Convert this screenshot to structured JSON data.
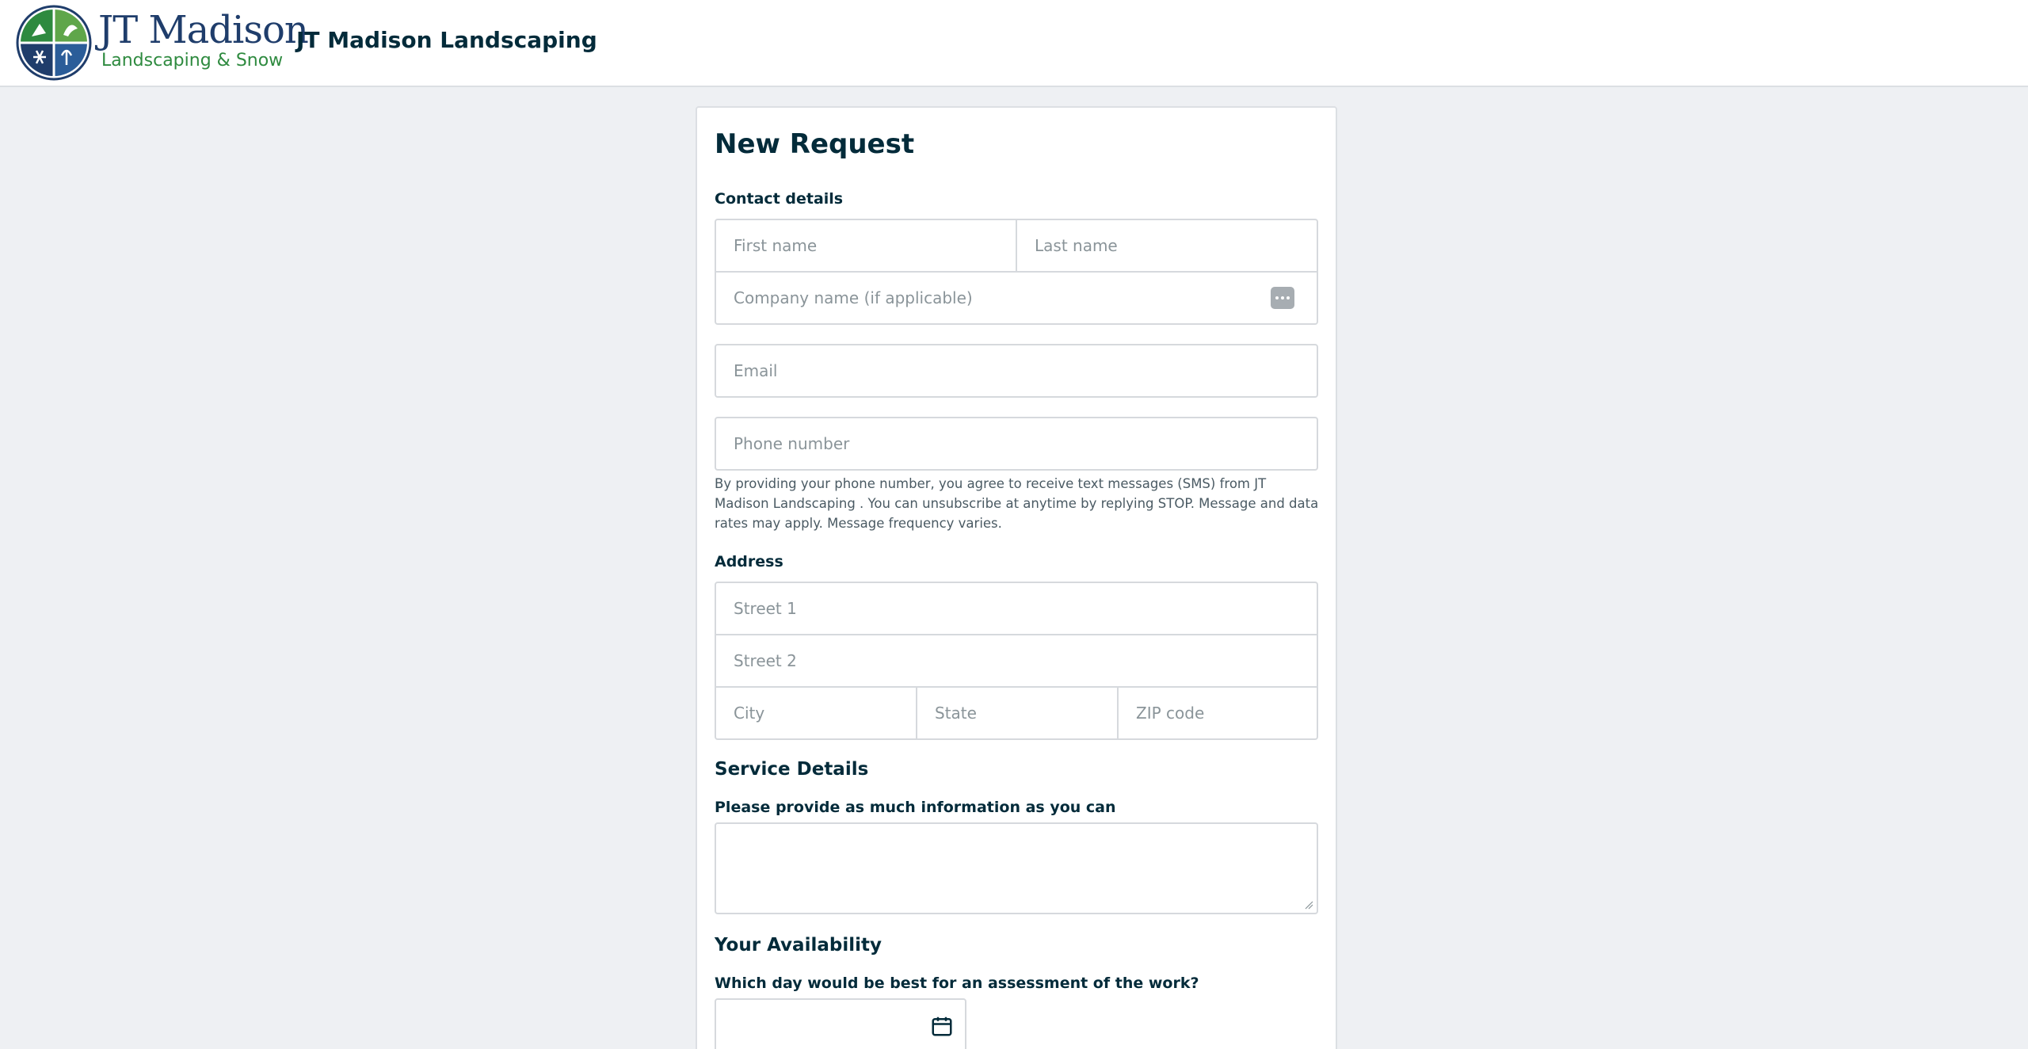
{
  "header": {
    "logo": {
      "wordmark": "JT Madison",
      "tagline": "Landscaping & Snow",
      "icon": "logo-seal-icon"
    },
    "company_name": "JT Madison Landscaping"
  },
  "form": {
    "title": "New Request",
    "contact": {
      "heading": "Contact details",
      "first_name_placeholder": "First name",
      "last_name_placeholder": "Last name",
      "company_placeholder": "Company name (if applicable)",
      "email_placeholder": "Email",
      "phone_placeholder": "Phone number",
      "sms_disclaimer": "By providing your phone number, you agree to receive text messages (SMS) from JT Madison Landscaping . You can unsubscribe at anytime by replying STOP. Message and data rates may apply. Message frequency varies."
    },
    "address": {
      "heading": "Address",
      "street1_placeholder": "Street 1",
      "street2_placeholder": "Street 2",
      "city_placeholder": "City",
      "state_placeholder": "State",
      "zip_placeholder": "ZIP code"
    },
    "service": {
      "heading": "Service Details",
      "prompt": "Please provide as much information as you can",
      "details_value": ""
    },
    "availability": {
      "heading": "Your Availability",
      "question": "Which day would be best for an assessment of the work?",
      "date_value": "",
      "icon": "calendar-icon"
    }
  },
  "colors": {
    "page_bg": "#eef0f3",
    "text_dark": "#032b3a",
    "placeholder": "#8a9499",
    "border": "#d6d9dd",
    "logo_blue": "#1f3d6b",
    "logo_green": "#2e8a3f"
  }
}
